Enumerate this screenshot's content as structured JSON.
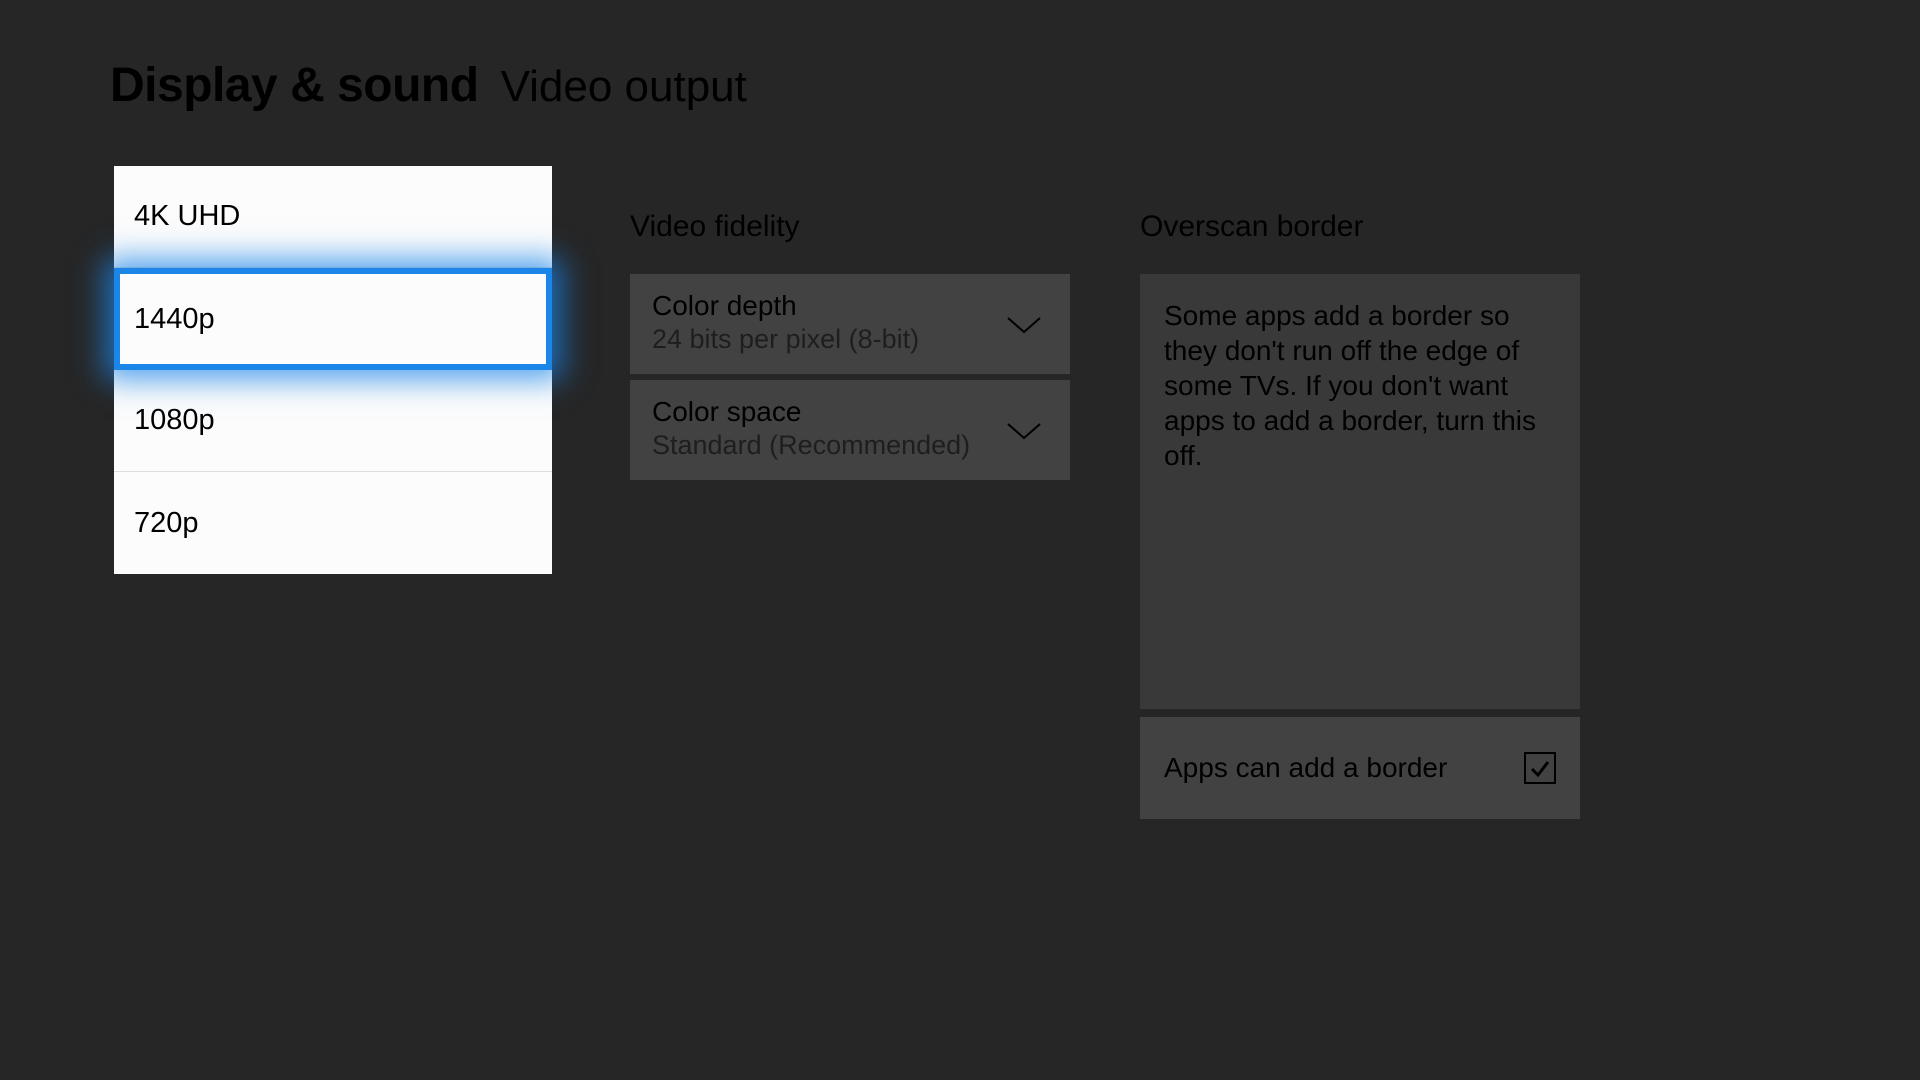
{
  "header": {
    "title": "Display & sound",
    "subtitle": "Video output"
  },
  "resolution_popup": {
    "options": [
      {
        "label": "4K UHD",
        "selected": false
      },
      {
        "label": "1440p",
        "selected": true
      },
      {
        "label": "1080p",
        "selected": false
      },
      {
        "label": "720p",
        "selected": false
      }
    ]
  },
  "video_fidelity": {
    "section_title": "Video fidelity",
    "color_depth": {
      "label": "Color depth",
      "value": "24 bits per pixel (8-bit)"
    },
    "color_space": {
      "label": "Color space",
      "value": "Standard (Recommended)"
    }
  },
  "overscan": {
    "section_title": "Overscan border",
    "description": "Some apps add a border so they don't run off the edge of some TVs. If you don't want apps to add a border, turn this off.",
    "checkbox_label": "Apps can add a border",
    "checked": true
  }
}
